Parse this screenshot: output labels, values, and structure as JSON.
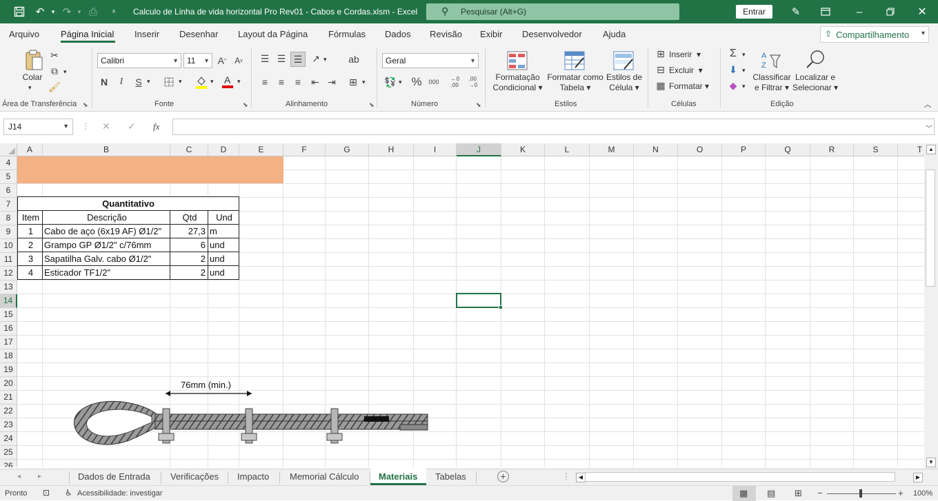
{
  "titlebar": {
    "title": "Calculo de Linha de vida horizontal  Pro Rev01 - Cabos e Cordas.xlsm  -  Excel",
    "search_placeholder": "Pesquisar (Alt+G)",
    "signin_label": "Entrar"
  },
  "menu": {
    "tabs": [
      "Arquivo",
      "Página Inicial",
      "Inserir",
      "Desenhar",
      "Layout da Página",
      "Fórmulas",
      "Dados",
      "Revisão",
      "Exibir",
      "Desenvolvedor",
      "Ajuda"
    ],
    "active_tab": "Página Inicial",
    "share_label": "Compartilhamento"
  },
  "ribbon": {
    "clipboard": {
      "paste_label": "Colar",
      "group_label": "Área de Transferência"
    },
    "font": {
      "font_name": "Calibri",
      "font_size": "11",
      "bold": "N",
      "italic": "I",
      "underline": "S",
      "group_label": "Fonte"
    },
    "alignment": {
      "group_label": "Alinhamento"
    },
    "number": {
      "format": "Geral",
      "group_label": "Número"
    },
    "styles": {
      "conditional_line1": "Formatação",
      "conditional_line2": "Condicional",
      "table_line1": "Formatar como",
      "table_line2": "Tabela",
      "cell_line1": "Estilos de",
      "cell_line2": "Célula",
      "group_label": "Estilos"
    },
    "cells": {
      "insert_label": "Inserir",
      "delete_label": "Excluir",
      "format_label": "Formatar",
      "group_label": "Células"
    },
    "editing": {
      "sort_line1": "Classificar",
      "sort_line2": "e Filtrar",
      "find_line1": "Localizar e",
      "find_line2": "Selecionar",
      "group_label": "Edição"
    }
  },
  "formula_bar": {
    "name_box": "J14",
    "fx": "fx",
    "formula": ""
  },
  "grid": {
    "columns": [
      "A",
      "B",
      "C",
      "D",
      "E",
      "F",
      "G",
      "H",
      "I",
      "J",
      "K",
      "L",
      "M",
      "N",
      "O",
      "P",
      "Q",
      "R",
      "S",
      "T"
    ],
    "rows": [
      "4",
      "5",
      "6",
      "7",
      "8",
      "9",
      "10",
      "11",
      "12",
      "13",
      "14",
      "15",
      "16",
      "17",
      "18",
      "19",
      "20",
      "21",
      "22",
      "23",
      "24",
      "25",
      "26"
    ],
    "selected_cell": "J14",
    "highlight_color": "#f4b183"
  },
  "table": {
    "title": "Quantitativo",
    "headers": [
      "Item",
      "Descrição",
      "Qtd",
      "Und"
    ],
    "rows": [
      [
        "1",
        "Cabo de aço  (6x19 AF) Ø1/2\"",
        "27,3",
        "m"
      ],
      [
        "2",
        "Grampo GP Ø1/2\" c/76mm",
        "6",
        "und"
      ],
      [
        "3",
        "Sapatilha Galv. cabo Ø1/2\"",
        "2",
        "und"
      ],
      [
        "4",
        "Esticador TF1/2\"",
        "2",
        "und"
      ]
    ]
  },
  "drawing": {
    "dimension_label": "76mm (min.)"
  },
  "sheets": {
    "tabs": [
      "Dados de Entrada",
      "Verificações",
      "Impacto",
      "Memorial Cálculo",
      "Materiais",
      "Tabelas"
    ],
    "active": "Materiais"
  },
  "status": {
    "ready": "Pronto",
    "accessibility": "Acessibilidade: investigar",
    "zoom": "100%"
  }
}
